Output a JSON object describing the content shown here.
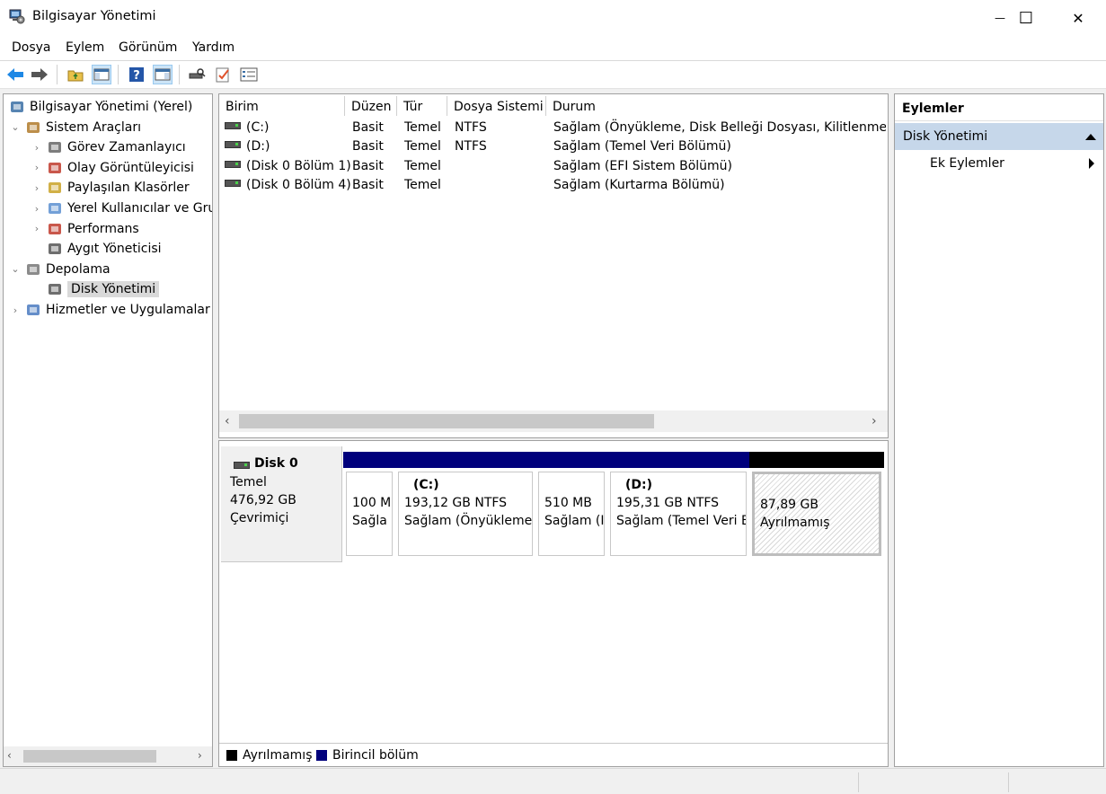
{
  "window": {
    "title": "Bilgisayar Yönetimi",
    "minimize": "—",
    "maximize": "☐",
    "close": "✕"
  },
  "menu": [
    "Dosya",
    "Eylem",
    "Görünüm",
    "Yardım"
  ],
  "toolbar": {
    "icons": [
      "back-arrow-icon",
      "forward-arrow-icon",
      "up-folder-icon",
      "show-hide-tree-icon",
      "help-icon",
      "show-hide-action-pane-icon",
      "disk-properties-icon",
      "check-icon",
      "list-icon"
    ]
  },
  "tree": {
    "items": [
      {
        "label": "Bilgisayar Yönetimi (Yerel)",
        "icon": "computer-management-icon",
        "indent": 0,
        "chevron": ""
      },
      {
        "label": "Sistem Araçları",
        "icon": "tools-icon",
        "indent": 1,
        "chevron": "⌄"
      },
      {
        "label": "Görev Zamanlayıcı",
        "icon": "clock-icon",
        "indent": 2,
        "chevron": "›"
      },
      {
        "label": "Olay Görüntüleyicisi",
        "icon": "event-viewer-icon",
        "indent": 2,
        "chevron": "›"
      },
      {
        "label": "Paylaşılan Klasörler",
        "icon": "shared-folder-icon",
        "indent": 2,
        "chevron": "›"
      },
      {
        "label": "Yerel Kullanıcılar ve Grup",
        "icon": "users-icon",
        "indent": 2,
        "chevron": "›"
      },
      {
        "label": "Performans",
        "icon": "performance-icon",
        "indent": 2,
        "chevron": "›"
      },
      {
        "label": "Aygıt Yöneticisi",
        "icon": "device-manager-icon",
        "indent": 2,
        "chevron": ""
      },
      {
        "label": "Depolama",
        "icon": "storage-icon",
        "indent": 1,
        "chevron": "⌄"
      },
      {
        "label": "Disk Yönetimi",
        "icon": "disk-management-icon",
        "indent": 2,
        "chevron": "",
        "selected": true
      },
      {
        "label": "Hizmetler ve Uygulamalar",
        "icon": "services-icon",
        "indent": 1,
        "chevron": "›"
      }
    ]
  },
  "volumes": {
    "columns": [
      "Birim",
      "Düzen",
      "Tür",
      "Dosya Sistemi",
      "Durum"
    ],
    "rows": [
      [
        "(C:)",
        "Basit",
        "Temel",
        "NTFS",
        "Sağlam (Önyükleme, Disk Belleği Dosyası, Kilitlenme Bilgi"
      ],
      [
        "(D:)",
        "Basit",
        "Temel",
        "NTFS",
        "Sağlam (Temel Veri Bölümü)"
      ],
      [
        "(Disk 0 Bölüm 1)",
        "Basit",
        "Temel",
        "",
        "Sağlam (EFI Sistem Bölümü)"
      ],
      [
        "(Disk 0 Bölüm 4)",
        "Basit",
        "Temel",
        "",
        "Sağlam (Kurtarma Bölümü)"
      ]
    ]
  },
  "disk": {
    "name": "Disk 0",
    "type": "Temel",
    "size": "476,92 GB",
    "status": "Çevrimiçi",
    "partitions": [
      {
        "title": "",
        "size": "100 M",
        "status": "Sağla",
        "color": "#00007c"
      },
      {
        "title": "(C:)",
        "size": "193,12 GB NTFS",
        "status": "Sağlam (Önyükleme,",
        "color": "#00007c"
      },
      {
        "title": "",
        "size": "510 MB",
        "status": "Sağlam (I",
        "color": "#00007c"
      },
      {
        "title": "(D:)",
        "size": "195,31 GB NTFS",
        "status": "Sağlam (Temel Veri B",
        "color": "#00007c"
      },
      {
        "title": "",
        "size": "87,89 GB",
        "status": "Ayrılmamış",
        "color": "#000000"
      }
    ]
  },
  "legend": [
    {
      "label": "Ayrılmamış",
      "color": "#000000"
    },
    {
      "label": "Birincil bölüm",
      "color": "#00007c"
    }
  ],
  "actions": {
    "title": "Eylemler",
    "section": "Disk Yönetimi",
    "more": "Ek Eylemler"
  }
}
